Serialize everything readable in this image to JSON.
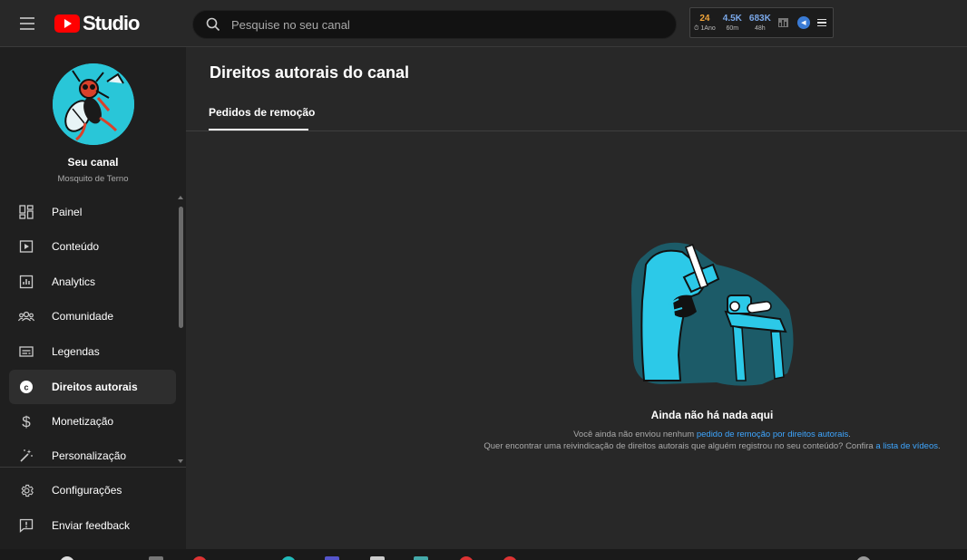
{
  "header": {
    "logo_text": "Studio",
    "search_placeholder": "Pesquise no seu canal",
    "stats": [
      {
        "value": "24",
        "label": "⏱ 1Ano",
        "color": "#f0a43a"
      },
      {
        "value": "4.5K",
        "label": "60m",
        "color": "#7aa7e8"
      },
      {
        "value": "683K",
        "label": "48h",
        "color": "#7aa7e8"
      }
    ]
  },
  "sidebar": {
    "channel_title": "Seu canal",
    "channel_name": "Mosquito de Terno",
    "items": [
      {
        "label": "Painel",
        "icon": "dashboard-icon"
      },
      {
        "label": "Conteúdo",
        "icon": "content-icon"
      },
      {
        "label": "Analytics",
        "icon": "analytics-icon"
      },
      {
        "label": "Comunidade",
        "icon": "community-icon"
      },
      {
        "label": "Legendas",
        "icon": "subtitles-icon"
      },
      {
        "label": "Direitos autorais",
        "icon": "copyright-icon",
        "active": true
      },
      {
        "label": "Monetização",
        "icon": "dollar-icon"
      },
      {
        "label": "Personalização",
        "icon": "magic-wand-icon"
      }
    ],
    "bottom_items": [
      {
        "label": "Configurações",
        "icon": "gear-icon"
      },
      {
        "label": "Enviar feedback",
        "icon": "feedback-icon"
      }
    ]
  },
  "main": {
    "title": "Direitos autorais do canal",
    "tabs": [
      {
        "label": "Pedidos de remoção",
        "active": true
      }
    ],
    "empty_state": {
      "title": "Ainda não há nada aqui",
      "line1_prefix": "Você ainda não enviou nenhum ",
      "line1_link": "pedido de remoção por direitos autorais",
      "line1_suffix": ".",
      "line2_prefix": "Quer encontrar uma reivindicação de direitos autorais que alguém registrou no seu conteúdo? Confira ",
      "line2_link": "a lista de vídeos",
      "line2_suffix": "."
    }
  },
  "colors": {
    "accent_link": "#3ea6ff",
    "brand_red": "#ff0000",
    "illustration_cyan": "#2cc9e8",
    "illustration_dark": "#1c5b68"
  }
}
